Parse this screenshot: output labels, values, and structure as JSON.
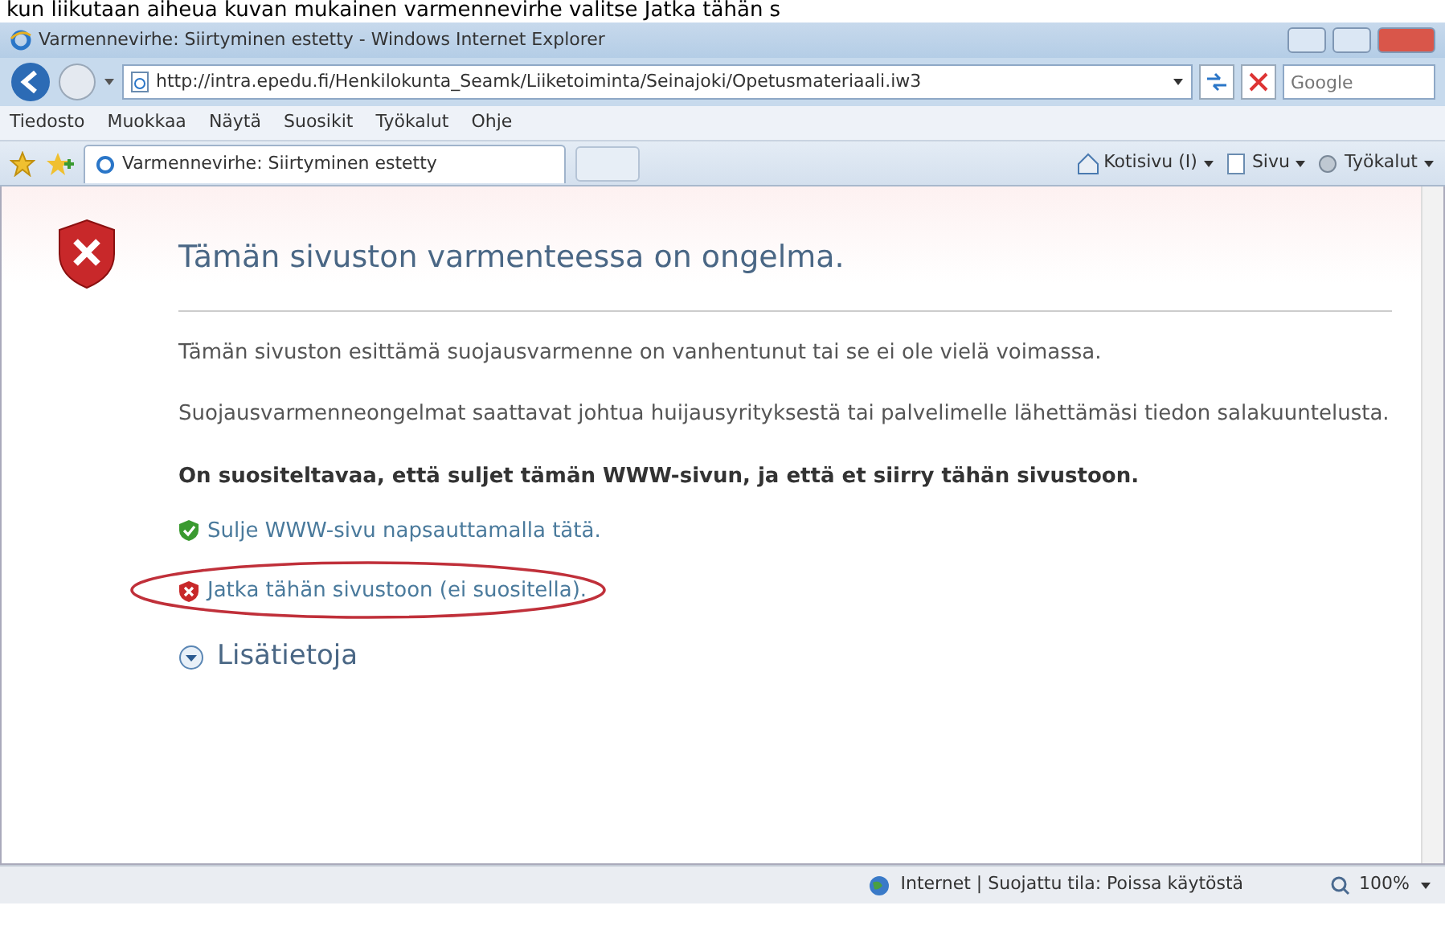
{
  "caption": "kun liikutaan aiheua kuvan mukainen varmennevirhe valitse Jatka tähän s",
  "window": {
    "title": "Varmennevirhe: Siirtyminen estetty - Windows Internet Explorer"
  },
  "address": {
    "url": "http://intra.epedu.fi/Henkilokunta_Seamk/Liiketoiminta/Seinajoki/Opetusmateriaali.iw3"
  },
  "search": {
    "placeholder": "Google"
  },
  "menu": [
    "Tiedosto",
    "Muokkaa",
    "Näytä",
    "Suosikit",
    "Työkalut",
    "Ohje"
  ],
  "tabs": [
    {
      "label": "Varmennevirhe: Siirtyminen estetty",
      "selected": true
    }
  ],
  "commands": [
    {
      "kind": "home",
      "label": "Kotisivu (I)"
    },
    {
      "kind": "page",
      "label": "Sivu"
    },
    {
      "kind": "tools",
      "label": "Työkalut"
    }
  ],
  "content": {
    "heading": "Tämän sivuston varmenteessa on ongelma.",
    "paragraphs": [
      "Tämän sivuston esittämä suojausvarmenne on vanhentunut tai se ei ole vielä voimassa.",
      "Suojausvarmenneongelmat saattavat johtua huijausyrityksestä tai palvelimelle lähettämäsi tiedon salakuuntelusta."
    ],
    "recommendation": "On suositeltavaa, että suljet tämän WWW-sivun, ja että et siirry tähän sivustoon.",
    "links": [
      {
        "kind": "safe",
        "text": "Sulje WWW-sivu napsauttamalla tätä.",
        "circled": false
      },
      {
        "kind": "unsafe",
        "text": "Jatka tähän sivustoon (ei suositella).",
        "circled": true
      }
    ],
    "more_info": {
      "text": "Lisätietoja",
      "expanded": false
    }
  },
  "status_bar": {
    "zone": "Internet | Suojattu tila: Poissa käytöstä",
    "zoom": "100%"
  }
}
